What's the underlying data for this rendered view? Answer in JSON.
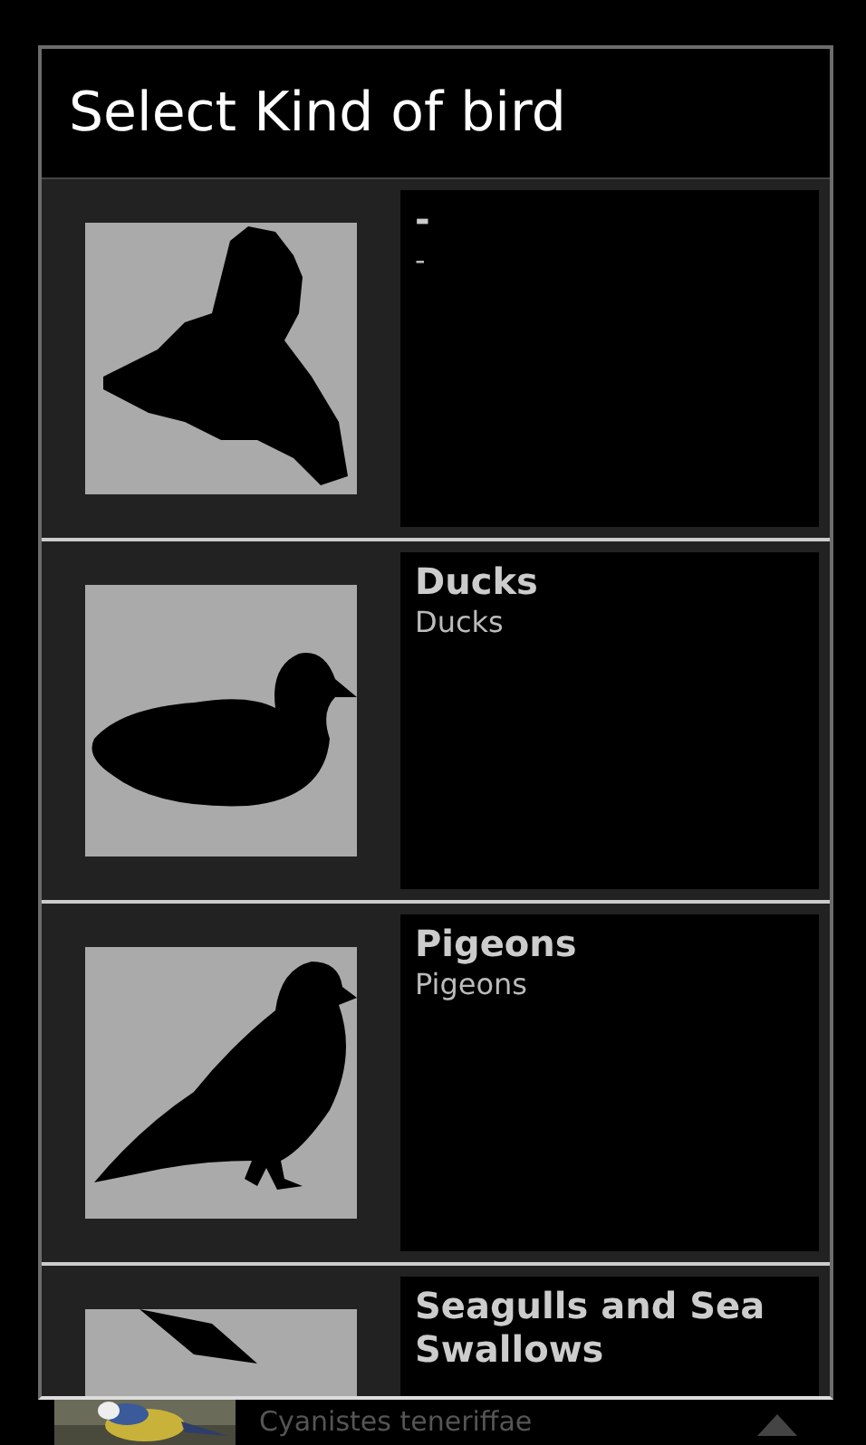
{
  "dialog": {
    "title": "Select Kind of bird",
    "items": [
      {
        "name": "-",
        "subtitle": "-"
      },
      {
        "name": "Ducks",
        "subtitle": "Ducks"
      },
      {
        "name": "Pigeons",
        "subtitle": "Pigeons"
      },
      {
        "name": "Seagulls and Sea Swallows"
      }
    ]
  },
  "background_list": {
    "subtitle": "Cyanistes teneriffae"
  }
}
